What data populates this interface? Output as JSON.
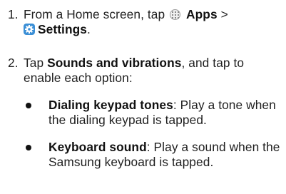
{
  "steps": [
    {
      "number": "1.",
      "text_before": "From a Home screen, tap",
      "apps_label": "Apps",
      "separator": ">",
      "settings_label": "Settings",
      "end": "."
    },
    {
      "number": "2.",
      "text_before": "Tap",
      "bold": "Sounds and vibrations",
      "text_after": ", and tap to enable each option:"
    }
  ],
  "options": [
    {
      "title": "Dialing keypad tones",
      "description": ": Play a tone when the dialing keypad is tapped."
    },
    {
      "title": "Keyboard sound",
      "description": ": Play a sound when the Samsung keyboard is tapped."
    }
  ],
  "icons": {
    "apps": "apps-grid-icon",
    "settings": "settings-gear-icon",
    "settings_color": "#3b8fd6"
  }
}
